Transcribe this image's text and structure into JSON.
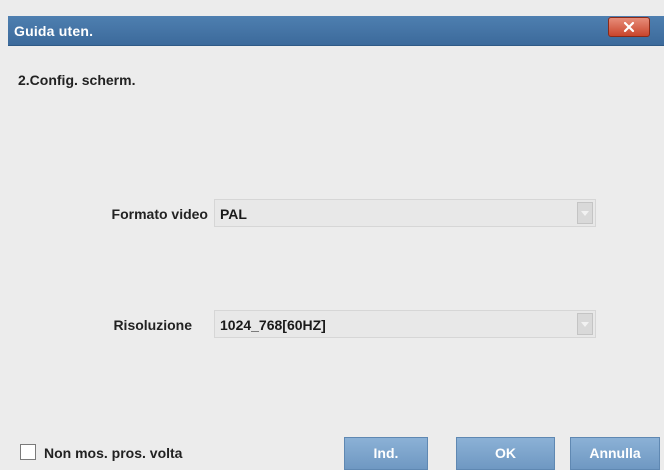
{
  "window": {
    "title": "Guida uten.",
    "close_icon": "close-icon"
  },
  "step": {
    "title": "2.Config. scherm."
  },
  "fields": {
    "video_format": {
      "label": "Formato video",
      "value": "PAL"
    },
    "resolution": {
      "label": "Risoluzione",
      "value": "1024_768[60HZ]"
    }
  },
  "footer": {
    "checkbox_label": "Non mos. pros. volta",
    "checkbox_checked": false,
    "back_label": "Ind.",
    "ok_label": "OK",
    "cancel_label": "Annulla"
  },
  "colors": {
    "titlebar": "#4e7fb0",
    "button": "#7ea5cc",
    "close_button": "#d4553c",
    "background": "#ececec"
  }
}
